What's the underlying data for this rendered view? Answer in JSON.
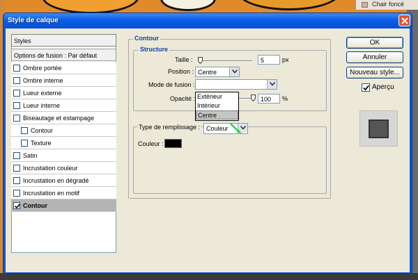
{
  "background": {
    "swatch_label": "Chair foncé"
  },
  "window": {
    "title": "Style de calque"
  },
  "styles_panel": {
    "header": "Styles",
    "fusion_options": "Options de fusion : Par défaut",
    "items": [
      {
        "label": "Ombre portée",
        "checked": false
      },
      {
        "label": "Ombre interne",
        "checked": false
      },
      {
        "label": "Lueur externe",
        "checked": false
      },
      {
        "label": "Lueur interne",
        "checked": false
      },
      {
        "label": "Biseautage et estampage",
        "checked": false
      },
      {
        "label": "Contour",
        "checked": false,
        "sub": true
      },
      {
        "label": "Texture",
        "checked": false,
        "sub": true
      },
      {
        "label": "Satin",
        "checked": false
      },
      {
        "label": "Incrustation couleur",
        "checked": false
      },
      {
        "label": "Incrustation en dégradé",
        "checked": false
      },
      {
        "label": "Incrustation en motif",
        "checked": false
      },
      {
        "label": "Contour",
        "checked": true,
        "selected": true
      }
    ]
  },
  "contour": {
    "group_title": "Contour",
    "structure_title": "Structure",
    "size_label": "Taille :",
    "size_value": "5",
    "size_unit": "px",
    "position_label": "Position :",
    "position_value": "Centre",
    "position_options": [
      "Extérieur",
      "Intérieur",
      "Centre"
    ],
    "blend_label": "Mode de fusion :",
    "opacity_label": "Opacité :",
    "opacity_value": "100",
    "opacity_unit": "%",
    "fill_type_label": "Type de remplissage :",
    "fill_type_value": "Couleur",
    "color_label": "Couleur :"
  },
  "buttons": {
    "ok": "OK",
    "cancel": "Annuler",
    "new_style": "Nouveau style...",
    "preview_label": "Aperçu",
    "preview_checked": true
  },
  "colors": {
    "title_blue": "#0a5ee8",
    "group_title_blue": "#0f3eb0",
    "stroke_color": "#000000"
  }
}
